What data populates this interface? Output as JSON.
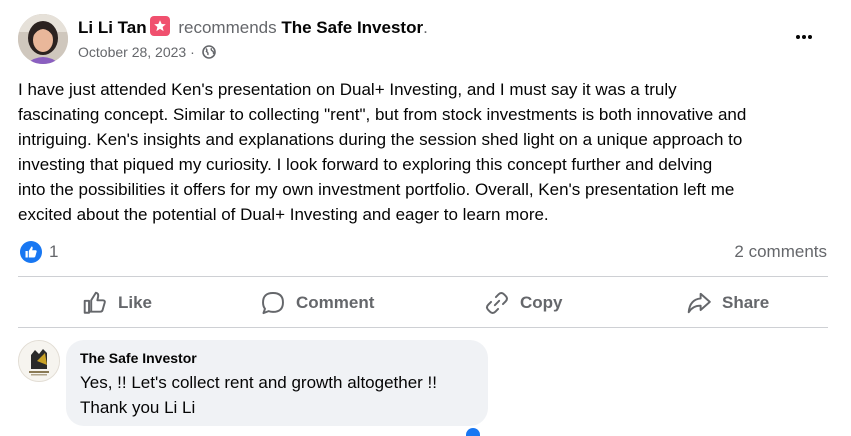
{
  "post": {
    "author": "Li Li Tan",
    "action_text": "recommends",
    "page_name": "The Safe Investor",
    "trailing_period": ".",
    "date": "October 28, 2023",
    "separator": "·",
    "audience_icon": "globe-icon",
    "body": "I have just attended Ken's presentation on Dual+ Investing, and I must say it was a truly\nfascinating concept. Similar to collecting \"rent\", but from stock investments is both innovative and\nintriguing. Ken's insights and explanations during the session shed light on a unique approach to\ninvesting that piqued my curiosity. I look forward to exploring this concept further and delving\ninto the possibilities it offers for my own investment portfolio. Overall, Ken's presentation left me\nexcited about the potential of Dual+ Investing and eager to learn more."
  },
  "reactions": {
    "like_count": "1",
    "comments_count": "2 comments"
  },
  "actions": {
    "like": "Like",
    "comment": "Comment",
    "copy": "Copy",
    "share": "Share"
  },
  "comment": {
    "author": "The Safe Investor",
    "text": "Yes, !! Let's collect rent and growth altogether !!\nThank you Li Li"
  },
  "colors": {
    "accent": "#1877f2",
    "badge": "#f0506e",
    "secondary_text": "#65676b",
    "bubble": "#f0f2f5"
  }
}
